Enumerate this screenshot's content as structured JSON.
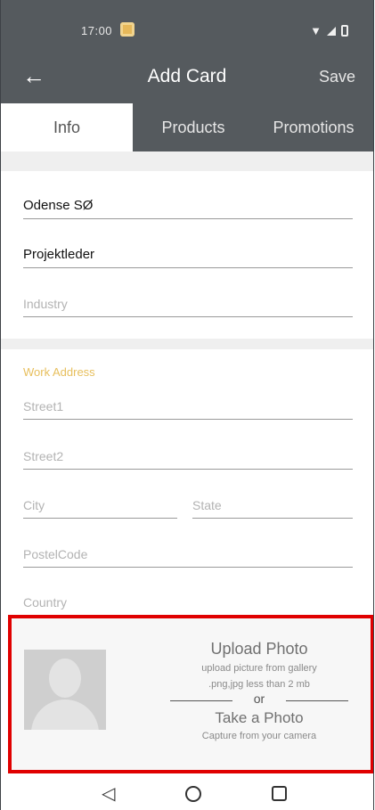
{
  "status_bar": {
    "time": "17:00"
  },
  "app_bar": {
    "title": "Add Card",
    "save_label": "Save"
  },
  "tabs": [
    {
      "label": "Info",
      "active": true
    },
    {
      "label": "Products",
      "active": false
    },
    {
      "label": "Promotions",
      "active": false
    }
  ],
  "fields": {
    "company": {
      "value": "Odense SØ"
    },
    "job_title": {
      "value": "Projektleder"
    },
    "industry": {
      "placeholder": "Industry"
    }
  },
  "work_address": {
    "label": "Work Address",
    "street1": {
      "placeholder": "Street1"
    },
    "street2": {
      "placeholder": "Street2"
    },
    "city": {
      "placeholder": "City"
    },
    "state": {
      "placeholder": "State"
    },
    "postal_code": {
      "placeholder": "PostelCode"
    },
    "country": {
      "placeholder": "Country"
    }
  },
  "upload": {
    "title": "Upload Photo",
    "subtitle1": "upload picture from gallery",
    "subtitle2": ".png,jpg less than 2 mb",
    "or": "or",
    "take_photo": "Take a Photo",
    "capture": "Capture from your camera"
  },
  "colors": {
    "toolbar": "#555a5e",
    "accent": "#e7bf5d",
    "highlight": "#e00000"
  }
}
